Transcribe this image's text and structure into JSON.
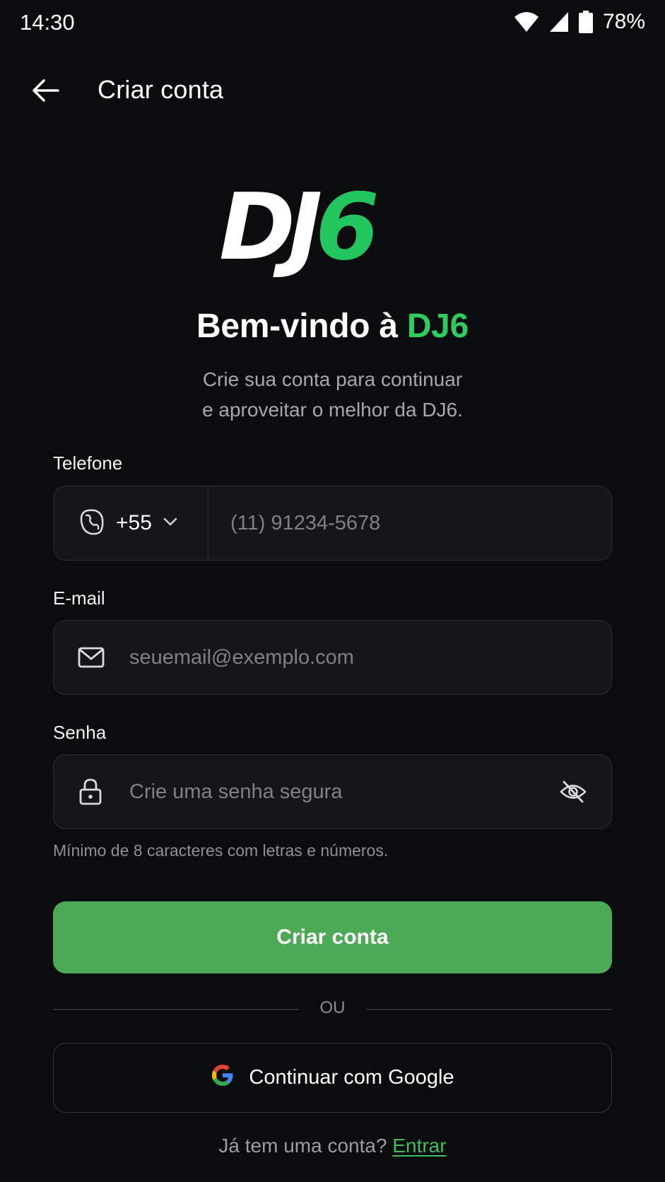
{
  "status_bar": {
    "time": "14:30",
    "battery": "78%"
  },
  "header": {
    "title": "Criar conta",
    "back_icon": "arrow-left-icon"
  },
  "logo": {
    "part_white": "DJ",
    "part_green": "6",
    "colors": {
      "white": "#ffffff",
      "green": "#22c55e"
    }
  },
  "welcome": {
    "prefix": "Bem-vindo à ",
    "brand": "DJ6"
  },
  "subtitle": {
    "line1": "Crie sua conta para continuar",
    "line2": "e aproveitar o melhor da DJ6."
  },
  "form": {
    "phone": {
      "label": "Telefone",
      "country_code": "+55",
      "placeholder": "(11) 91234-5678",
      "value": ""
    },
    "email": {
      "label": "E-mail",
      "placeholder": "seuemail@exemplo.com",
      "value": ""
    },
    "password": {
      "label": "Senha",
      "placeholder": "Crie uma senha segura",
      "value": "",
      "hint": "Mínimo de 8 caracteres com letras e números."
    }
  },
  "actions": {
    "submit_label": "Criar conta",
    "divider_text": "OU",
    "google_label": "Continuar com Google",
    "login_prompt": "Já tem uma conta?",
    "login_link": "Entrar"
  },
  "colors": {
    "accent": "#4caa57",
    "brand_green": "#2ecc5f",
    "background": "#0b0c0d",
    "field_bg": "#141619"
  }
}
